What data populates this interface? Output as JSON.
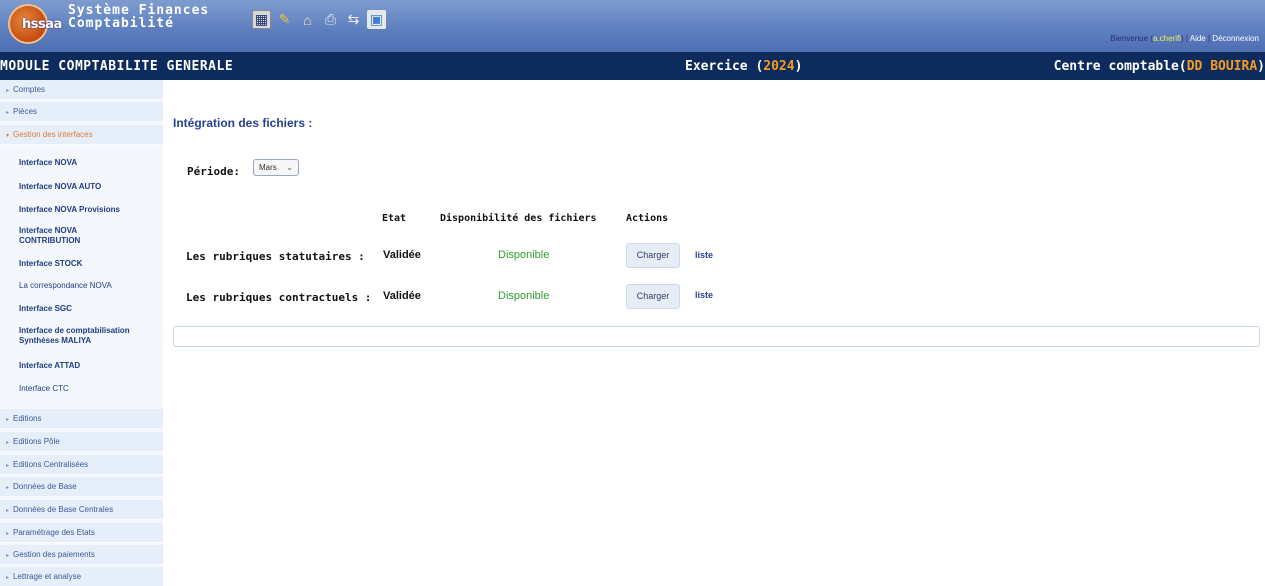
{
  "app": {
    "logo_text": "hssaa",
    "title_line1": "Système Finances",
    "title_line2": "Comptabilité",
    "toolbar_icons": [
      "calculator-icon",
      "tools-icon",
      "home-icon",
      "print-icon",
      "arrows-icon",
      "monitor-icon"
    ],
    "user": {
      "prefix": "Bienvenue (",
      "username": "a.cherifi",
      "suffix": ")",
      "aide": "Aide",
      "separator": "|",
      "deconnexion": "Déconnexion"
    }
  },
  "header": {
    "module": "MODULE COMPTABILITE GENERALE",
    "exercice_label": "Exercice (",
    "exercice_year": "2024",
    "exercice_close": ")",
    "centre_label": "Centre comptable(",
    "centre_name": "DD BOUIRA",
    "centre_close": ")"
  },
  "sidebar": {
    "top_items": [
      {
        "label": "Comptes"
      },
      {
        "label": "Pièces"
      },
      {
        "label": "Gestion des interfaces"
      }
    ],
    "sub_items": [
      {
        "label": "Interface NOVA"
      },
      {
        "label": "Interface NOVA AUTO"
      },
      {
        "label": "Interface NOVA Provisions"
      },
      {
        "label": "Interface NOVA CONTRIBUTION"
      },
      {
        "label": "Interface STOCK"
      },
      {
        "label": "La correspondance NOVA"
      },
      {
        "label": "Interface SGC"
      },
      {
        "label": "Interface de comptabilisation Synthèses MALIYA"
      },
      {
        "label": "Interface ATTAD"
      },
      {
        "label": "Interface CTC"
      }
    ],
    "bottom_items": [
      {
        "label": "Editions"
      },
      {
        "label": "Editions Pôle"
      },
      {
        "label": "Editions Centralisées"
      },
      {
        "label": "Données de Base"
      },
      {
        "label": "Données de Base Centrales"
      },
      {
        "label": "Paramétrage des Etats"
      },
      {
        "label": "Gestion des paiements"
      },
      {
        "label": "Lettrage et analyse"
      }
    ]
  },
  "main": {
    "section_title": "Intégration des fichiers :",
    "period_label": "Période:",
    "period_value": "Mars",
    "columns": {
      "etat": "Etat",
      "disponibilite": "Disponibilité des fichiers",
      "actions": "Actions"
    },
    "rows": [
      {
        "label": "Les rubriques statutaires :",
        "etat": "Validée",
        "dispo": "Disponible",
        "button": "Charger",
        "link": "liste"
      },
      {
        "label": "Les rubriques contractuels :",
        "etat": "Validée",
        "dispo": "Disponible",
        "button": "Charger",
        "link": "liste"
      }
    ]
  },
  "colors": {
    "banner": "#5f80c0",
    "header_bar": "#0d2b5c",
    "accent_orange": "#f59a23",
    "available_green": "#2f9e2f"
  }
}
